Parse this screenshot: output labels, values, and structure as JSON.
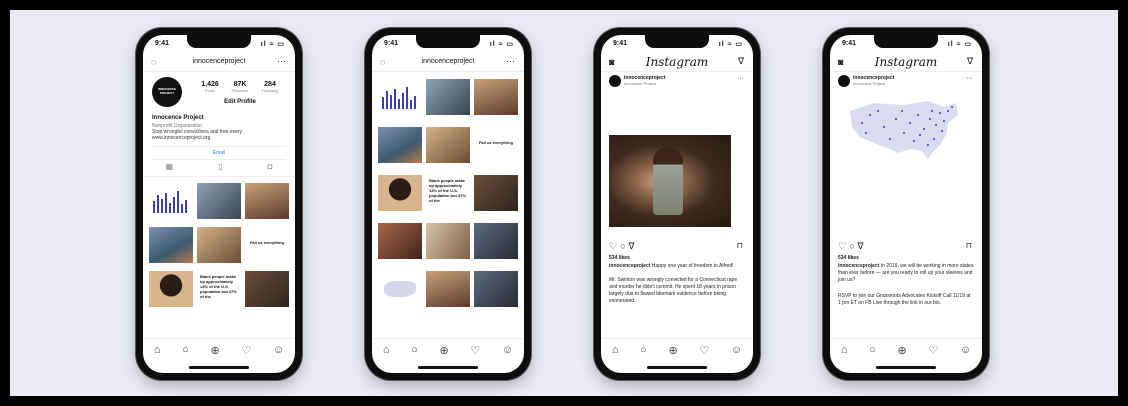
{
  "status_time": "9:41",
  "status_icons": "ıl ≈ ▭",
  "tab_icons": [
    "⌂",
    "○",
    "⊕",
    "♡",
    "☺"
  ],
  "colors": {
    "accent": "#3b3fa8",
    "background": "#e9eaf4"
  },
  "phone1": {
    "username": "innocenceproject",
    "avatar_text": "INNOCENCE PROJECT",
    "stats": [
      {
        "value": "1,426",
        "label": "Posts"
      },
      {
        "value": "87K",
        "label": "Followers"
      },
      {
        "value": "284",
        "label": "Following"
      }
    ],
    "edit_profile": "Edit Profile",
    "name": "Innocence Project",
    "category": "Nonprofit Organization",
    "bio": "Stop wrongful convictions and free every",
    "url": "www.innocenceproject.org",
    "email": "Email",
    "text_tile": "Black people make up approximately 13% of the U.S. population but 47% of the",
    "mark_tile": "Fail us everything"
  },
  "phone2": {
    "username": "innocenceproject",
    "text_tile": "Black people make up approximately 13% of the U.S. population but 47% of the",
    "mark_tile": "Fail us everything"
  },
  "phone3": {
    "logo": "Instagram",
    "account": "innocenceproject",
    "subtitle": "Innocence Project",
    "likes": "534 likes",
    "caption_user": "innocenceproject",
    "caption": "Happy one year of freedom to Alfred!",
    "body": "Mr. Swinton was wrongly convicted for a Connecticut rape and murder he didn't commit. He spent 18 years in prison largely due to flawed bitemark evidence before being exonerated."
  },
  "phone4": {
    "logo": "Instagram",
    "account": "innocenceproject",
    "subtitle": "Innocence Project",
    "likes": "534 likes",
    "caption_user": "innocenceproject",
    "caption": "In 2019, we will be working in more states than ever before — are you ready to roll up your sleeves and join us?",
    "body": "RSVP to join our Grassroots Advocates Kickoff Call 11/19 at 1 pm ET on FB Live through the link in our bio."
  }
}
